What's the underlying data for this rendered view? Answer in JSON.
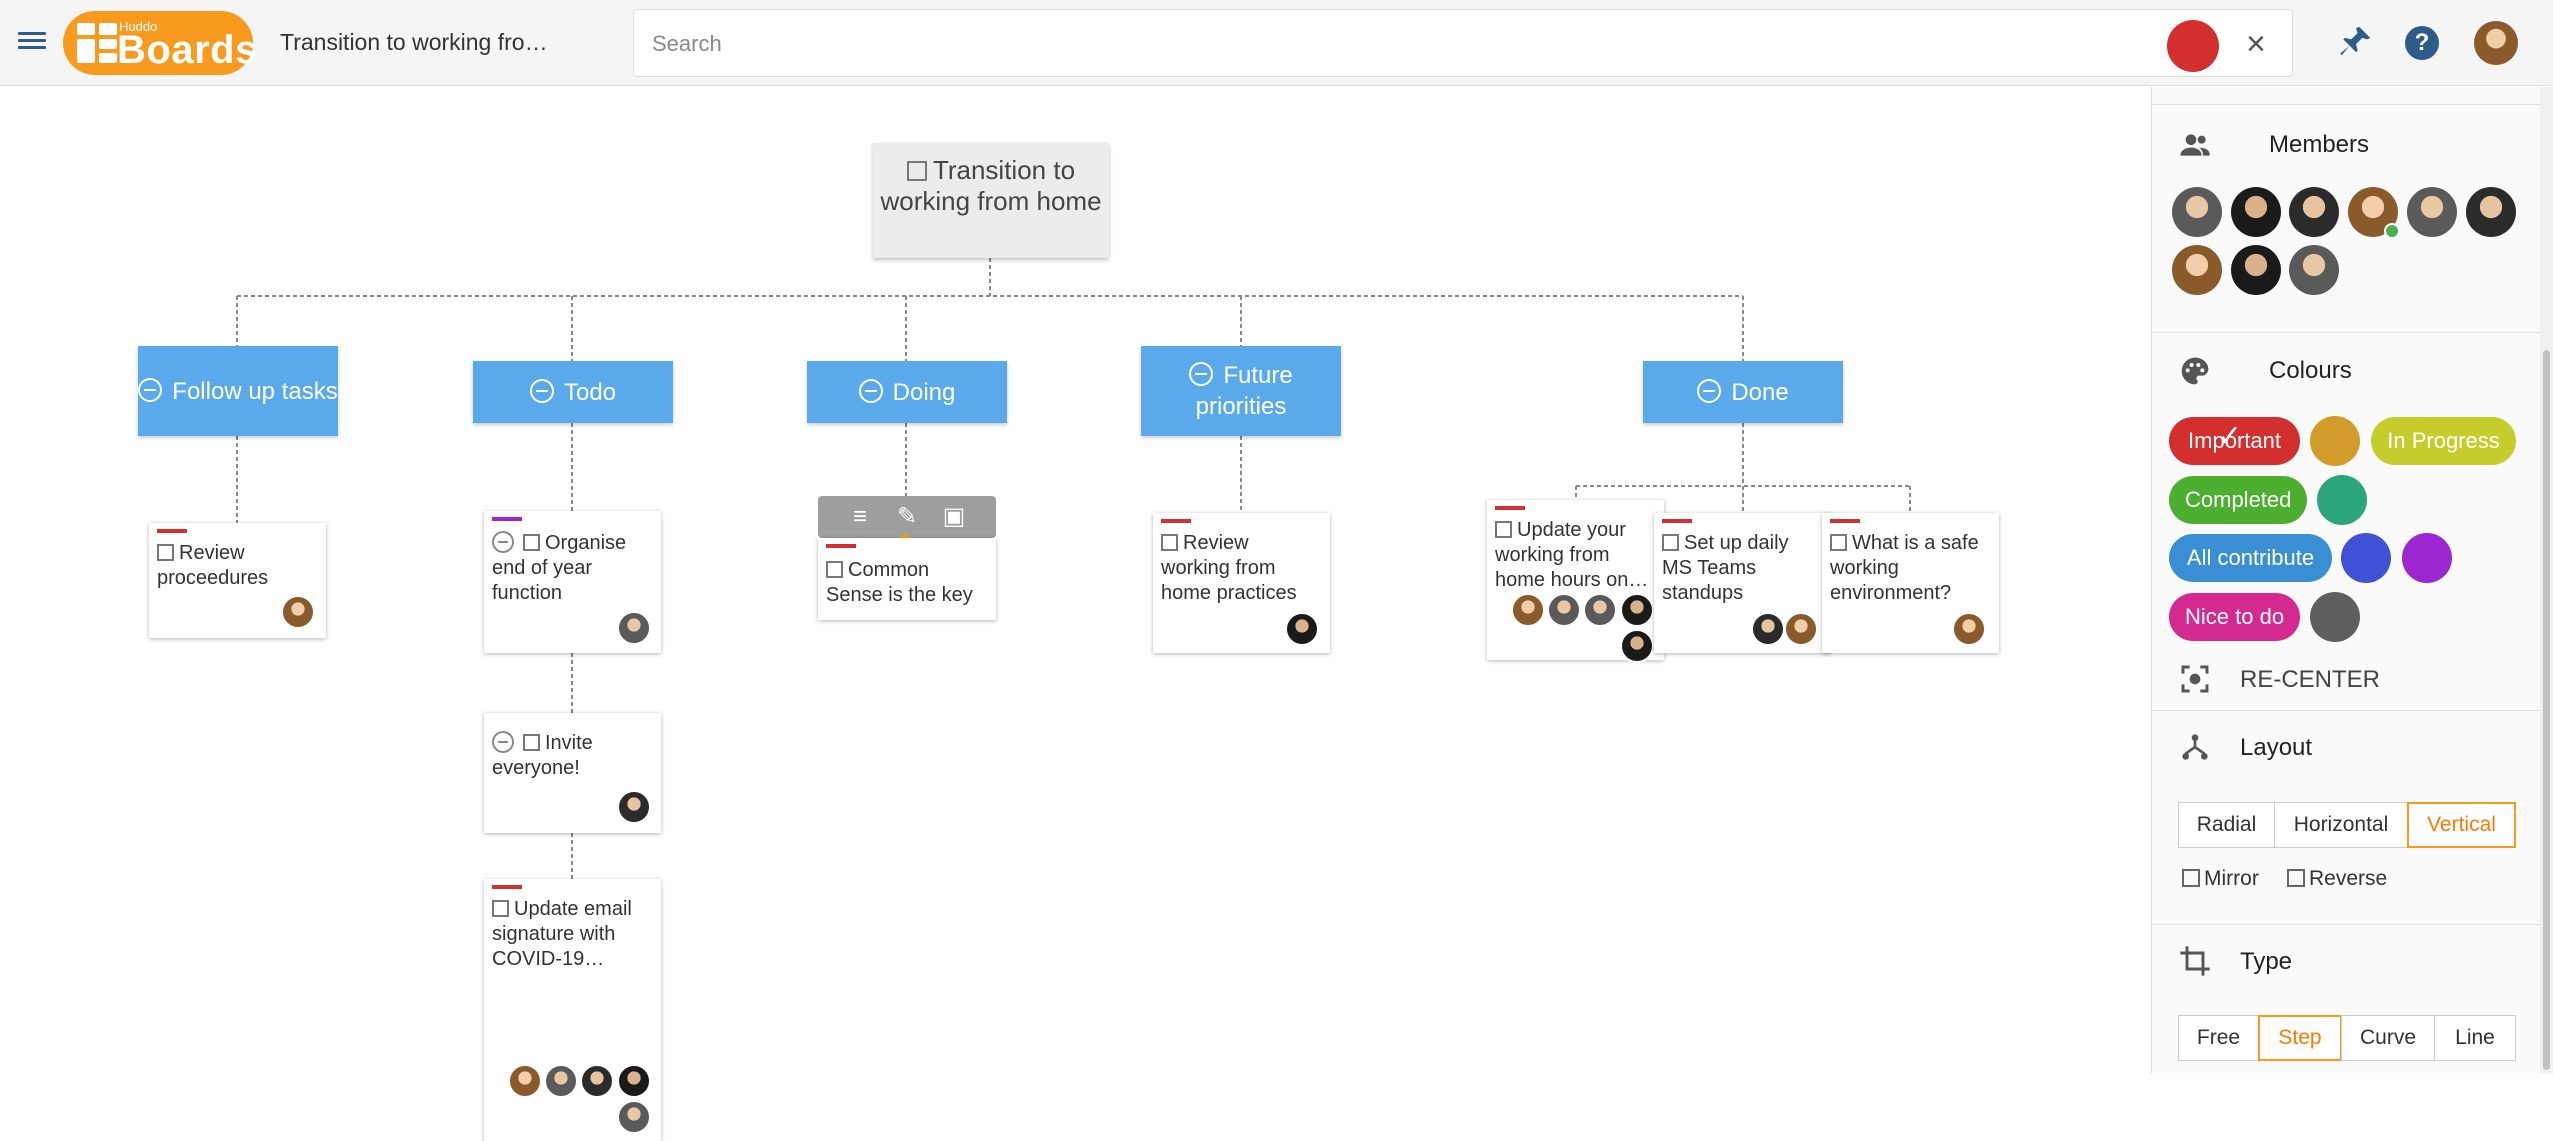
{
  "header": {
    "logo_small": "Huddo",
    "logo_big": "Boards",
    "board_title": "Transition to working fro…",
    "search_placeholder": "Search",
    "clear_icon": "×",
    "help_label": "?"
  },
  "board": {
    "root": "Transition to working from home",
    "columns": [
      {
        "title": "Follow up tasks"
      },
      {
        "title": "Todo"
      },
      {
        "title": "Doing"
      },
      {
        "title": "Future priorities"
      },
      {
        "title": "Done"
      }
    ],
    "cards": {
      "review_proceedures": "Review proceedures",
      "organise": "Organise end of year function",
      "invite": "Invite everyone!",
      "update_email": "Update email signature with COVID-19…",
      "common_sense": "Common Sense is the key",
      "review_practices": "Review working from home practices",
      "update_hours": "Update your working from home hours on…",
      "daily_standups": "Set up daily MS Teams standups",
      "safe_env": "What is a safe working environment?"
    }
  },
  "panel": {
    "members_title": "Members",
    "colours_title": "Colours",
    "colour_labels": {
      "important": "Important",
      "in_progress": "In Progress",
      "completed": "Completed",
      "all_contribute": "All contribute",
      "nice_to_do": "Nice to do"
    },
    "recenter_label": "RE-CENTER",
    "layout_title": "Layout",
    "layout_options": {
      "radial": "Radial",
      "horizontal": "Horizontal",
      "vertical": "Vertical"
    },
    "mirror_label": "Mirror",
    "reverse_label": "Reverse",
    "type_title": "Type",
    "type_options": {
      "free": "Free",
      "step": "Step",
      "curve": "Curve",
      "line": "Line"
    }
  },
  "colors": {
    "brand": "#f79a1d",
    "column": "#5aa9ea",
    "important": "#d32f2f",
    "mustard": "#d39b2a",
    "in_progress": "#c5cc2c",
    "completed": "#4caf2f",
    "teal": "#2aa57c",
    "all_contribute": "#3a8fd4",
    "blue": "#3f51d5",
    "purple": "#9c27d0",
    "nice_to_do": "#d42a8f",
    "grey": "#5f5f5f"
  }
}
